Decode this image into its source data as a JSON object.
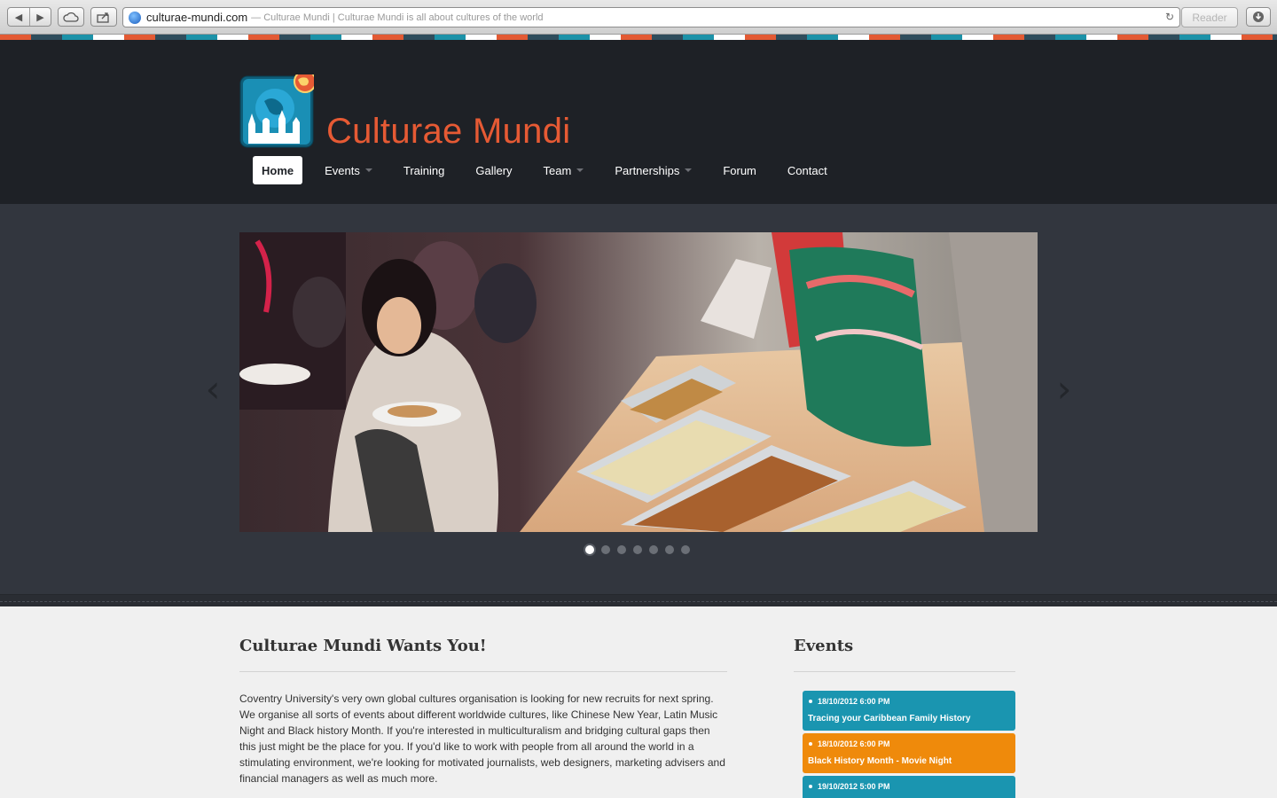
{
  "browser": {
    "domain": "culturae-mundi.com",
    "page_title": "— Culturae Mundi | Culturae Mundi is all about cultures of the world",
    "reader_label": "Reader"
  },
  "site": {
    "title": "Culturae Mundi",
    "accent": "#e65a34"
  },
  "nav": {
    "items": [
      {
        "label": "Home",
        "active": true,
        "dropdown": false
      },
      {
        "label": "Events",
        "active": false,
        "dropdown": true
      },
      {
        "label": "Training",
        "active": false,
        "dropdown": false
      },
      {
        "label": "Gallery",
        "active": false,
        "dropdown": false
      },
      {
        "label": "Team",
        "active": false,
        "dropdown": true
      },
      {
        "label": "Partnerships",
        "active": false,
        "dropdown": true
      },
      {
        "label": "Forum",
        "active": false,
        "dropdown": false
      },
      {
        "label": "Contact",
        "active": false,
        "dropdown": false
      }
    ]
  },
  "slider": {
    "prev_glyph": "‹",
    "next_glyph": "›",
    "slide_count": 7,
    "active_slide": 1
  },
  "main": {
    "title": "Culturae Mundi Wants You!",
    "body": "Coventry University's very own global cultures organisation is looking for new recruits for next spring. We organise all sorts of events about different worldwide cultures, like Chinese New Year, Latin Music Night and Black history Month. If you're interested in multiculturalism and bridging cultural gaps then this just might be the place for you. If you'd like to work with people from all around the world in a stimulating environment, we're looking for motivated journalists, web designers, marketing advisers and financial managers as well as much more."
  },
  "events": {
    "title": "Events",
    "items": [
      {
        "date": "18/10/2012 6:00 PM",
        "title": "Tracing your Caribbean Family History",
        "color": "#1a95b0"
      },
      {
        "date": "18/10/2012 6:00 PM",
        "title": "Black History Month - Movie Night",
        "color": "#ef8a0b"
      },
      {
        "date": "19/10/2012 5:00 PM",
        "title": "",
        "color": "#1a95b0"
      }
    ]
  }
}
